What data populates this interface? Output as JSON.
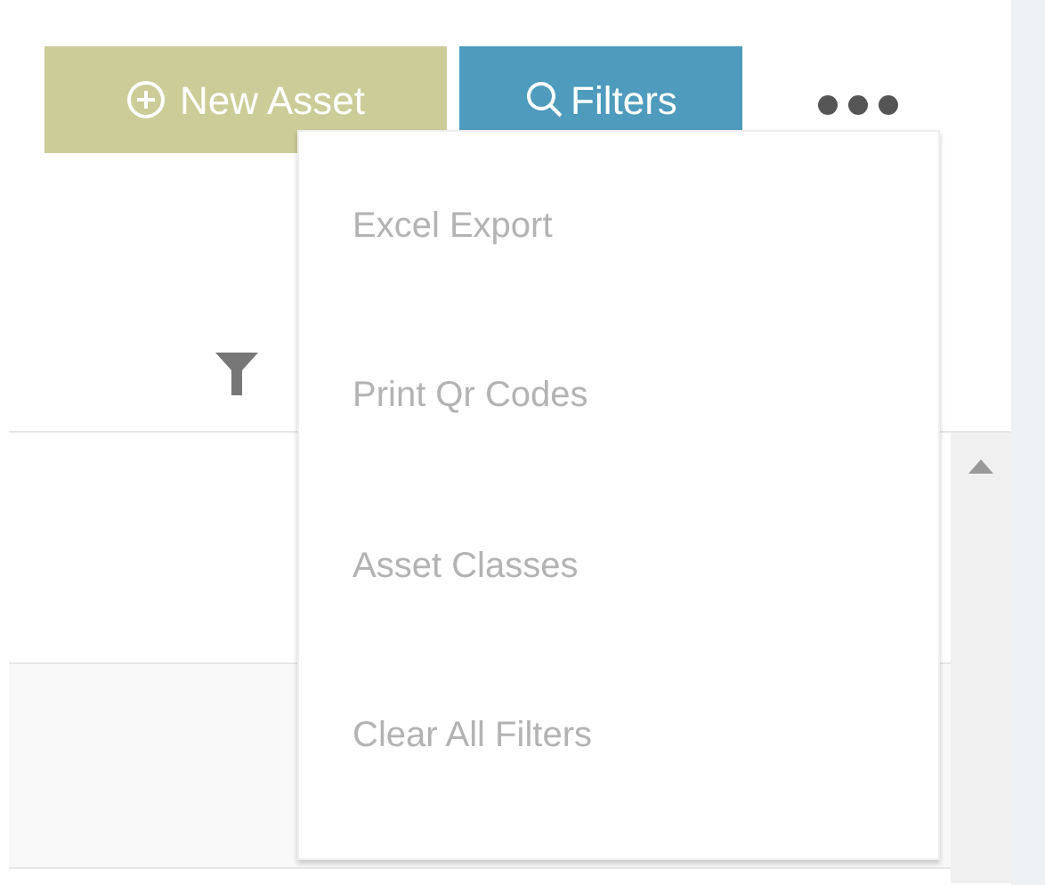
{
  "toolbar": {
    "new_asset_button": "New Asset",
    "filters_button": "Filters"
  },
  "more_menu": {
    "open": true,
    "items": [
      {
        "label": "Excel Export"
      },
      {
        "label": "Print Qr Codes"
      },
      {
        "label": "Asset Classes"
      },
      {
        "label": "Clear All Filters"
      }
    ]
  }
}
